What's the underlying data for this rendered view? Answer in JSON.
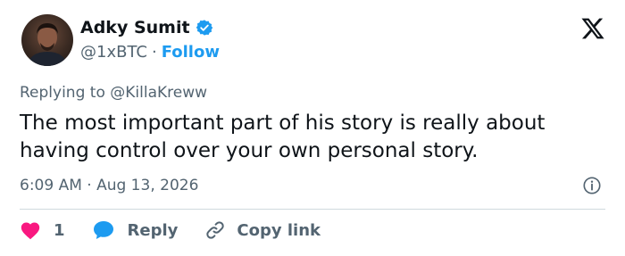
{
  "author": {
    "name": "Adky Sumit",
    "handle": "@1xBTC",
    "separator": "·",
    "follow_label": "Follow"
  },
  "reply_context": {
    "prefix": "Replying to ",
    "mention": "@KillaKreww"
  },
  "tweet": {
    "text": "The most important part of his story is really about having control over your own personal story.",
    "timestamp": "6:09 AM · Aug 13, 2026"
  },
  "actions": {
    "like_count": "1",
    "reply_label": "Reply",
    "copy_label": "Copy link"
  },
  "colors": {
    "accent": "#1d9bf0",
    "like": "#f91880",
    "text_primary": "#0f1419",
    "text_secondary": "#536471",
    "divider": "#cfd9de"
  },
  "icons": [
    "verified-badge-icon",
    "x-logo-icon",
    "info-icon",
    "heart-icon",
    "reply-bubble-icon",
    "link-icon"
  ]
}
